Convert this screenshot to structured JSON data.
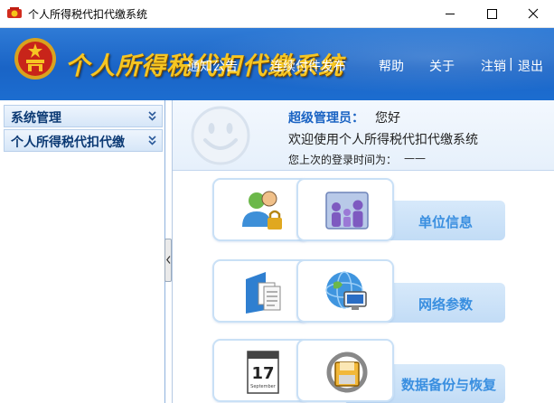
{
  "window": {
    "title": "个人所得税代扣代缴系统"
  },
  "header": {
    "brand": "个人所得税代扣代缴系统",
    "nav": {
      "notice": "通知公告",
      "announce": "连续付件发布",
      "help": "帮助",
      "about": "关于",
      "logout": "注销",
      "separator": "|",
      "exit": "退出"
    }
  },
  "sidebar": {
    "items": [
      {
        "label": "系统管理"
      },
      {
        "label": "个人所得税代扣代缴"
      }
    ]
  },
  "welcome": {
    "role": "超级管理员：",
    "greeting": "您好",
    "message": "欢迎使用个人所得税代扣代缴系统",
    "last_login_label": "您上次的登录时间为：",
    "last_login_value": "——"
  },
  "modules": [
    {
      "label": "单位信息",
      "icons": [
        "user-lock-icon",
        "family-icon"
      ]
    },
    {
      "label": "网络参数",
      "icons": [
        "documents-icon",
        "network-globe-icon"
      ]
    },
    {
      "label": "数据备份与恢复",
      "icons": [
        "calendar-icon",
        "backup-restore-icon"
      ]
    }
  ],
  "calendar_icon": {
    "day": "17",
    "month": "September"
  },
  "colors": {
    "banner": "#1a64c6",
    "brand_gold": "#f6c623",
    "band_label": "#3a8fe0"
  }
}
